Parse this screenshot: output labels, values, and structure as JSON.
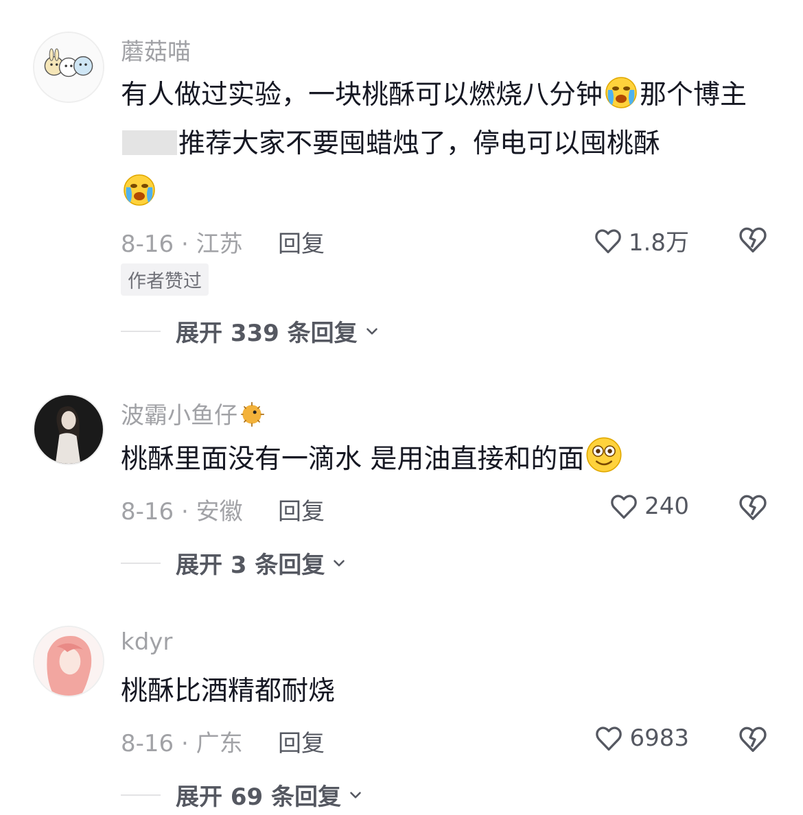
{
  "comments": [
    {
      "username": "蘑菇喵",
      "text_parts": [
        "有人做过实验，一块桃酥可以燃烧八分钟",
        "那个博主",
        "推荐大家不要囤蜡烛了，停电可以囤桃酥"
      ],
      "date_location": "8-16 · 江苏",
      "reply_label": "回复",
      "likes": "1.8万",
      "badge": "作者赞过",
      "expand_label": "展开 339 条回复"
    },
    {
      "username": "波霸小鱼仔",
      "text_parts": [
        "桃酥里面没有一滴水 是用油直接和的面"
      ],
      "date_location": "8-16 · 安徽",
      "reply_label": "回复",
      "likes": "240",
      "expand_label": "展开 3 条回复"
    },
    {
      "username": "kdyr",
      "text_parts": [
        "桃酥比酒精都耐烧"
      ],
      "date_location": "8-16 · 广东",
      "reply_label": "回复",
      "likes": "6983",
      "expand_label": "展开 69 条回复"
    }
  ],
  "icons": {
    "like": "heart-outline-icon",
    "dislike": "broken-heart-icon",
    "expand": "chevron-down-icon",
    "emoji_cry": "crying-emoji-icon",
    "emoji_smile": "smile-emoji-icon",
    "emoji_puffer": "pufferfish-emoji-icon"
  },
  "colors": {
    "text_primary": "#161823",
    "text_secondary": "#a1a2a6",
    "action_text": "#555861",
    "badge_bg": "#f2f2f4"
  }
}
